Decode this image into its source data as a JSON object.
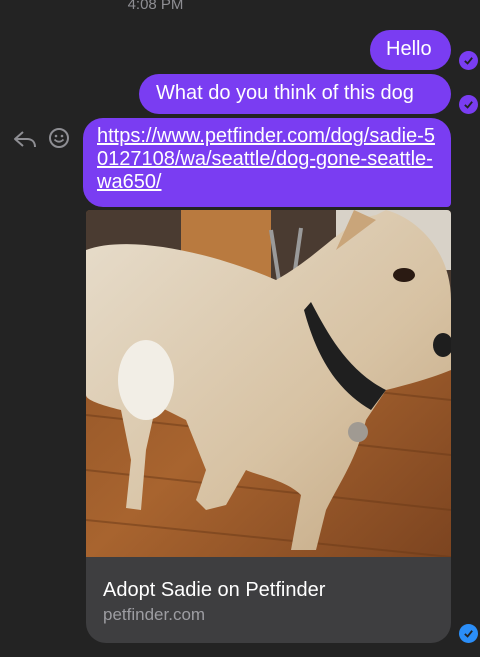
{
  "status": {
    "time": "4:08 PM"
  },
  "messages": [
    {
      "text": "Hello",
      "read": true
    },
    {
      "text": "What do you think of this dog",
      "read": true
    },
    {
      "link": "https://www.petfinder.com/dog/sadie-50127108/wa/seattle/dog-gone-seattle-wa650/"
    }
  ],
  "link_preview": {
    "title": "Adopt Sadie on Petfinder",
    "domain": "petfinder.com",
    "image_icon": "dog-photo"
  },
  "icons": {
    "reply": "reply-icon",
    "reaction": "emoji-icon",
    "read_receipt": "check-icon",
    "sent_receipt": "check-icon"
  },
  "colors": {
    "background": "#232323",
    "bubble": "#7a3df2",
    "sent_check": "#2b8ef8",
    "card": "#3e3e40"
  }
}
